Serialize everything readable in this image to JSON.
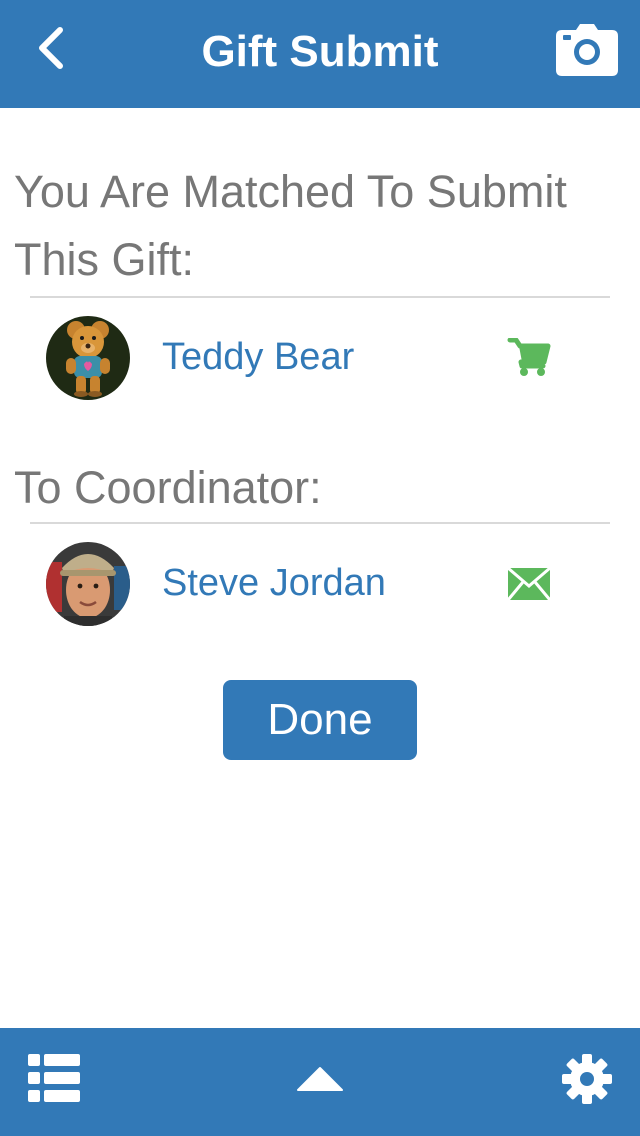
{
  "header": {
    "title": "Gift Submit",
    "back_icon": "chevron-left-icon",
    "camera_icon": "camera-icon"
  },
  "gift_section": {
    "label": "You Are Matched To Submit This Gift:",
    "item": {
      "name": "Teddy Bear",
      "avatar_icon": "teddy-bear-avatar",
      "action_icon": "shopping-cart-icon",
      "action_color": "#5cb85c"
    }
  },
  "coordinator_section": {
    "label": "To Coordinator:",
    "item": {
      "name": "Steve Jordan",
      "avatar_icon": "person-avatar",
      "action_icon": "envelope-icon",
      "action_color": "#5cb85c"
    }
  },
  "done_button": {
    "label": "Done"
  },
  "footer": {
    "list_icon": "list-icon",
    "up_icon": "triangle-up-icon",
    "settings_icon": "gear-icon"
  },
  "colors": {
    "brand": "#3279b7",
    "accent_green": "#5cb85c",
    "label_gray": "#777777"
  }
}
